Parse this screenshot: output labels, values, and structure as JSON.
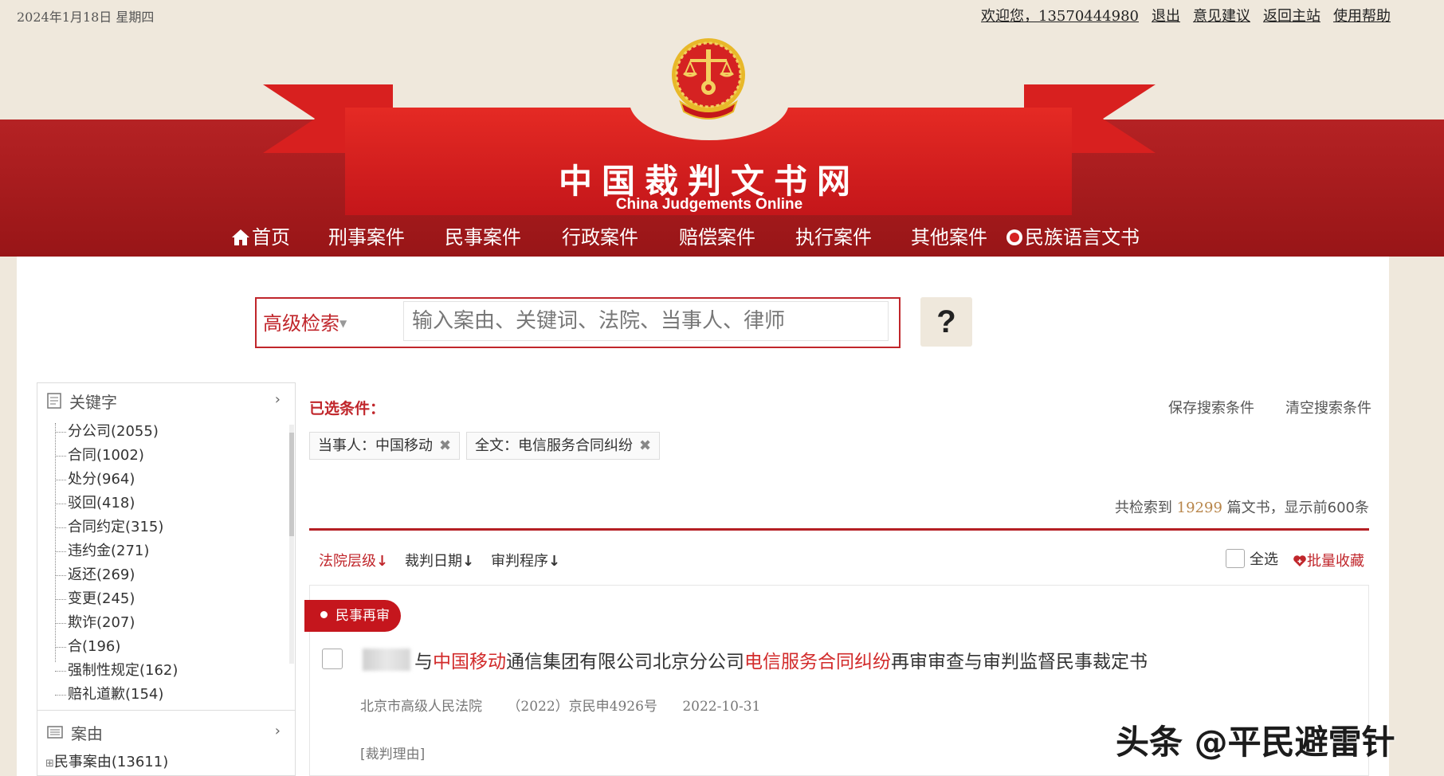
{
  "topbar": {
    "date": "2024年1月18日 星期四",
    "welcome": "欢迎您，13570444980",
    "logout": "退出",
    "feedback": "意见建议",
    "return_home": "返回主站",
    "help": "使用帮助"
  },
  "header": {
    "title": "中国裁判文书网",
    "subtitle": "China Judgements Online",
    "nav": [
      "首页",
      "刑事案件",
      "民事案件",
      "行政案件",
      "赔偿案件",
      "执行案件",
      "其他案件",
      "民族语言文书"
    ]
  },
  "search": {
    "advanced_label": "高级检索",
    "placeholder": "输入案由、关键词、法院、当事人、律师",
    "help_label": "?"
  },
  "sidebar": {
    "keyword_header": "关键字",
    "keywords": [
      "分公司(2055)",
      "合同(1002)",
      "处分(964)",
      "驳回(418)",
      "合同约定(315)",
      "违约金(271)",
      "返还(269)",
      "变更(245)",
      "欺诈(207)",
      "合(196)",
      "强制性规定(162)",
      "赔礼道歉(154)"
    ],
    "cause_header": "案由",
    "causes": [
      "民事案由(13611)"
    ]
  },
  "conditions": {
    "label": "已选条件：",
    "save": "保存搜索条件",
    "clear": "清空搜索条件",
    "tags": [
      "当事人：中国移动",
      "全文：电信服务合同纠纷"
    ],
    "remove_symbol": "✖"
  },
  "results": {
    "total_prefix": "共检索到",
    "total_count": "19299",
    "total_suffix": "篇文书，显示前600条",
    "sort": [
      "法院层级",
      "裁判日期",
      "审判程序"
    ],
    "sort_arrow": "↓",
    "select_all": "全选",
    "batch_favorite": "批量收藏",
    "items": [
      {
        "type_badge": "民事再审",
        "title_parts": [
          "与",
          "中国移动",
          "通信集团有限公司北京分公司",
          "电信服务合同纠纷",
          "再审审查与审判监督民事裁定书"
        ],
        "court": "北京市高级人民法院",
        "case_no": "（2022）京民申4926号",
        "date": "2022-10-31",
        "reason": "[裁判理由]"
      }
    ]
  },
  "watermark": "头条 @平民避雷针",
  "colors": {
    "brand_red": "#c0262b",
    "header_band": "#a81a1c",
    "page_bg": "#efe8dc",
    "count_gold": "#b8864b"
  }
}
